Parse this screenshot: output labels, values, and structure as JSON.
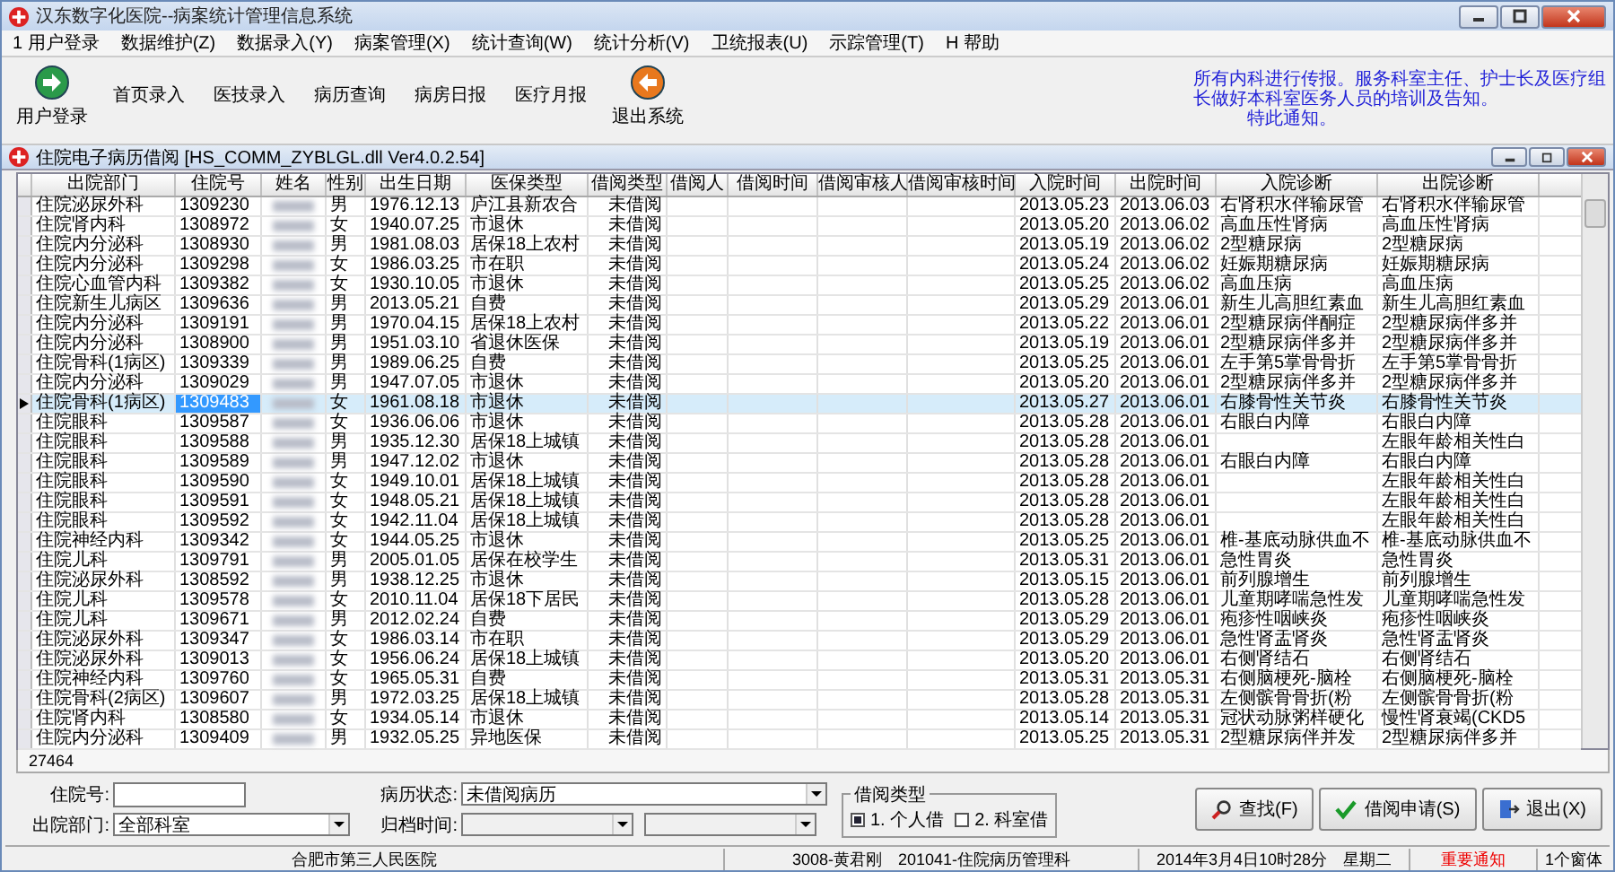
{
  "window": {
    "title": "汉东数字化医院--病案统计管理信息系统"
  },
  "menu": [
    "1 用户登录",
    "数据维护(Z)",
    "数据录入(Y)",
    "病案管理(X)",
    "统计查询(W)",
    "统计分析(V)",
    "卫统报表(U)",
    "示踪管理(T)",
    "H 帮助"
  ],
  "toolbar": [
    {
      "label": "用户登录",
      "kind": "login"
    },
    {
      "label": "首页录入",
      "kind": "text"
    },
    {
      "label": "医技录入",
      "kind": "text"
    },
    {
      "label": "病历查询",
      "kind": "text"
    },
    {
      "label": "病房日报",
      "kind": "text"
    },
    {
      "label": "医疗月报",
      "kind": "text"
    },
    {
      "label": "退出系统",
      "kind": "exit"
    }
  ],
  "notice": {
    "lines": [
      "所有内科进行传报。服务科室主任、护士长及医疗组",
      "长做好本科室医务人员的培训及告知。",
      "特此通知。"
    ]
  },
  "subwindow": {
    "title": "住院电子病历借阅 [HS_COMM_ZYBLGL.dll Ver4.0.2.54]"
  },
  "table": {
    "columns": [
      {
        "label": "出院部门",
        "kind": "text"
      },
      {
        "label": "住院号",
        "kind": "text"
      },
      {
        "label": "姓名",
        "kind": "blurred"
      },
      {
        "label": "性别",
        "kind": "text"
      },
      {
        "label": "出生日期",
        "kind": "text"
      },
      {
        "label": "医保类型",
        "kind": "text"
      },
      {
        "label": "借阅类型",
        "kind": "status"
      },
      {
        "label": "借阅人",
        "kind": "text"
      },
      {
        "label": "借阅时间",
        "kind": "text"
      },
      {
        "label": "借阅审核人",
        "kind": "text"
      },
      {
        "label": "借阅审核时间",
        "kind": "text"
      },
      {
        "label": "入院时间",
        "kind": "text"
      },
      {
        "label": "出院时间",
        "kind": "text"
      },
      {
        "label": "入院诊断",
        "kind": "text"
      },
      {
        "label": "出院诊断",
        "kind": "text"
      }
    ],
    "rows": [
      {
        "selected": false,
        "cells": [
          "住院泌尿外科",
          "1309230",
          "",
          "男",
          "1976.12.13",
          "庐江县新农合",
          "未借阅",
          "",
          "",
          "",
          "",
          "2013.05.23",
          "2013.06.03",
          "右肾积水伴输尿管",
          "右肾积水伴输尿管"
        ]
      },
      {
        "selected": false,
        "cells": [
          "住院肾内科",
          "1308972",
          "",
          "女",
          "1940.07.25",
          "市退休",
          "未借阅",
          "",
          "",
          "",
          "",
          "2013.05.20",
          "2013.06.02",
          "高血压性肾病",
          "高血压性肾病"
        ]
      },
      {
        "selected": false,
        "cells": [
          "住院内分泌科",
          "1308930",
          "",
          "男",
          "1981.08.03",
          "居保18上农村",
          "未借阅",
          "",
          "",
          "",
          "",
          "2013.05.19",
          "2013.06.02",
          "2型糖尿病",
          "2型糖尿病"
        ]
      },
      {
        "selected": false,
        "cells": [
          "住院内分泌科",
          "1309298",
          "",
          "女",
          "1986.03.25",
          "市在职",
          "未借阅",
          "",
          "",
          "",
          "",
          "2013.05.24",
          "2013.06.02",
          "妊娠期糖尿病",
          "妊娠期糖尿病"
        ]
      },
      {
        "selected": false,
        "cells": [
          "住院心血管内科",
          "1309382",
          "",
          "女",
          "1930.10.05",
          "市退休",
          "未借阅",
          "",
          "",
          "",
          "",
          "2013.05.25",
          "2013.06.02",
          "高血压病",
          "高血压病"
        ]
      },
      {
        "selected": false,
        "cells": [
          "住院新生儿病区",
          "1309636",
          "",
          "男",
          "2013.05.21",
          "自费",
          "未借阅",
          "",
          "",
          "",
          "",
          "2013.05.29",
          "2013.06.01",
          "新生儿高胆红素血",
          "新生儿高胆红素血"
        ]
      },
      {
        "selected": false,
        "cells": [
          "住院内分泌科",
          "1309191",
          "",
          "男",
          "1970.04.15",
          "居保18上农村",
          "未借阅",
          "",
          "",
          "",
          "",
          "2013.05.22",
          "2013.06.01",
          "2型糖尿病伴酮症",
          "2型糖尿病伴多并"
        ]
      },
      {
        "selected": false,
        "cells": [
          "住院内分泌科",
          "1308900",
          "",
          "男",
          "1951.03.10",
          "省退休医保",
          "未借阅",
          "",
          "",
          "",
          "",
          "2013.05.19",
          "2013.06.01",
          "2型糖尿病伴多并",
          "2型糖尿病伴多并"
        ]
      },
      {
        "selected": false,
        "cells": [
          "住院骨科(1病区)",
          "1309339",
          "",
          "男",
          "1989.06.25",
          "自费",
          "未借阅",
          "",
          "",
          "",
          "",
          "2013.05.25",
          "2013.06.01",
          "左手第5掌骨骨折",
          "左手第5掌骨骨折"
        ]
      },
      {
        "selected": false,
        "cells": [
          "住院内分泌科",
          "1309029",
          "",
          "男",
          "1947.07.05",
          "市退休",
          "未借阅",
          "",
          "",
          "",
          "",
          "2013.05.20",
          "2013.06.01",
          "2型糖尿病伴多并",
          "2型糖尿病伴多并"
        ]
      },
      {
        "selected": true,
        "cells": [
          "住院骨科(1病区)",
          "1309483",
          "",
          "女",
          "1961.08.18",
          "市退休",
          "未借阅",
          "",
          "",
          "",
          "",
          "2013.05.27",
          "2013.06.01",
          "右膝骨性关节炎",
          "右膝骨性关节炎"
        ]
      },
      {
        "selected": false,
        "cells": [
          "住院眼科",
          "1309587",
          "",
          "女",
          "1936.06.06",
          "市退休",
          "未借阅",
          "",
          "",
          "",
          "",
          "2013.05.28",
          "2013.06.01",
          "右眼白内障",
          "右眼白内障"
        ]
      },
      {
        "selected": false,
        "cells": [
          "住院眼科",
          "1309588",
          "",
          "男",
          "1935.12.30",
          "居保18上城镇",
          "未借阅",
          "",
          "",
          "",
          "",
          "2013.05.28",
          "2013.06.01",
          "",
          "左眼年龄相关性白"
        ]
      },
      {
        "selected": false,
        "cells": [
          "住院眼科",
          "1309589",
          "",
          "男",
          "1947.12.02",
          "市退休",
          "未借阅",
          "",
          "",
          "",
          "",
          "2013.05.28",
          "2013.06.01",
          "右眼白内障",
          "右眼白内障"
        ]
      },
      {
        "selected": false,
        "cells": [
          "住院眼科",
          "1309590",
          "",
          "女",
          "1949.10.01",
          "居保18上城镇",
          "未借阅",
          "",
          "",
          "",
          "",
          "2013.05.28",
          "2013.06.01",
          "",
          "左眼年龄相关性白"
        ]
      },
      {
        "selected": false,
        "cells": [
          "住院眼科",
          "1309591",
          "",
          "女",
          "1948.05.21",
          "居保18上城镇",
          "未借阅",
          "",
          "",
          "",
          "",
          "2013.05.28",
          "2013.06.01",
          "",
          "左眼年龄相关性白"
        ]
      },
      {
        "selected": false,
        "cells": [
          "住院眼科",
          "1309592",
          "",
          "女",
          "1942.11.04",
          "居保18上城镇",
          "未借阅",
          "",
          "",
          "",
          "",
          "2013.05.28",
          "2013.06.01",
          "",
          "左眼年龄相关性白"
        ]
      },
      {
        "selected": false,
        "cells": [
          "住院神经内科",
          "1309342",
          "",
          "女",
          "1944.05.25",
          "市退休",
          "未借阅",
          "",
          "",
          "",
          "",
          "2013.05.25",
          "2013.06.01",
          "椎-基底动脉供血不",
          "椎-基底动脉供血不"
        ]
      },
      {
        "selected": false,
        "cells": [
          "住院儿科",
          "1309791",
          "",
          "男",
          "2005.01.05",
          "居保在校学生",
          "未借阅",
          "",
          "",
          "",
          "",
          "2013.05.31",
          "2013.06.01",
          "急性胃炎",
          "急性胃炎"
        ]
      },
      {
        "selected": false,
        "cells": [
          "住院泌尿外科",
          "1308592",
          "",
          "男",
          "1938.12.25",
          "市退休",
          "未借阅",
          "",
          "",
          "",
          "",
          "2013.05.15",
          "2013.06.01",
          "前列腺增生",
          "前列腺增生"
        ]
      },
      {
        "selected": false,
        "cells": [
          "住院儿科",
          "1309578",
          "",
          "女",
          "2010.11.04",
          "居保18下居民",
          "未借阅",
          "",
          "",
          "",
          "",
          "2013.05.28",
          "2013.06.01",
          "儿童期哮喘急性发",
          "儿童期哮喘急性发"
        ]
      },
      {
        "selected": false,
        "cells": [
          "住院儿科",
          "1309671",
          "",
          "男",
          "2012.02.24",
          "自费",
          "未借阅",
          "",
          "",
          "",
          "",
          "2013.05.29",
          "2013.06.01",
          "疱疹性咽峡炎",
          "疱疹性咽峡炎"
        ]
      },
      {
        "selected": false,
        "cells": [
          "住院泌尿外科",
          "1309347",
          "",
          "女",
          "1986.03.14",
          "市在职",
          "未借阅",
          "",
          "",
          "",
          "",
          "2013.05.29",
          "2013.06.01",
          "急性肾盂肾炎",
          "急性肾盂肾炎"
        ]
      },
      {
        "selected": false,
        "cells": [
          "住院泌尿外科",
          "1309013",
          "",
          "女",
          "1956.06.24",
          "居保18上城镇",
          "未借阅",
          "",
          "",
          "",
          "",
          "2013.05.20",
          "2013.06.01",
          "右侧肾结石",
          "右侧肾结石"
        ]
      },
      {
        "selected": false,
        "cells": [
          "住院神经内科",
          "1309760",
          "",
          "女",
          "1965.05.31",
          "自费",
          "未借阅",
          "",
          "",
          "",
          "",
          "2013.05.31",
          "2013.05.31",
          "右侧脑梗死-脑栓",
          "右侧脑梗死-脑栓"
        ]
      },
      {
        "selected": false,
        "cells": [
          "住院骨科(2病区)",
          "1309607",
          "",
          "男",
          "1972.03.25",
          "居保18上城镇",
          "未借阅",
          "",
          "",
          "",
          "",
          "2013.05.28",
          "2013.05.31",
          "左侧髌骨骨折(粉",
          "左侧髌骨骨折(粉"
        ]
      },
      {
        "selected": false,
        "cells": [
          "住院肾内科",
          "1308580",
          "",
          "女",
          "1934.05.14",
          "市退休",
          "未借阅",
          "",
          "",
          "",
          "",
          "2013.05.14",
          "2013.05.31",
          "冠状动脉粥样硬化",
          "慢性肾衰竭(CKD5"
        ]
      },
      {
        "selected": false,
        "cells": [
          "住院内分泌科",
          "1309409",
          "",
          "男",
          "1932.05.25",
          "异地医保",
          "未借阅",
          "",
          "",
          "",
          "",
          "2013.05.25",
          "2013.05.31",
          "2型糖尿病伴并发",
          "2型糖尿病伴多并"
        ]
      }
    ],
    "total": "27464"
  },
  "filters": {
    "inpatient_no": {
      "label": "住院号:"
    },
    "discharge_dept": {
      "label": "出院部门:",
      "value": "全部科室"
    },
    "record_status": {
      "label": "病历状态:",
      "value": "未借阅病历"
    },
    "archive_time": {
      "label": "归档时间:"
    },
    "borrow_type": {
      "legend": "借阅类型",
      "options": [
        {
          "label": "1. 个人借",
          "checked": true
        },
        {
          "label": "2. 科室借",
          "checked": false
        }
      ]
    }
  },
  "buttons": [
    {
      "label": "查找(F)",
      "kind": "search"
    },
    {
      "label": "借阅申请(S)",
      "kind": "apply"
    },
    {
      "label": "退出(X)",
      "kind": "exit"
    }
  ],
  "status_bar": [
    {
      "text": "合肥市第三人民医院",
      "kind": "plain"
    },
    {
      "text": "3008-黄君刚　201041-住院病历管理科",
      "kind": "plain"
    },
    {
      "text": "2014年3月4日10时28分　星期二",
      "kind": "plain"
    },
    {
      "text": "重要通知",
      "kind": "alert"
    },
    {
      "text": "1个窗体",
      "kind": "plain"
    }
  ]
}
